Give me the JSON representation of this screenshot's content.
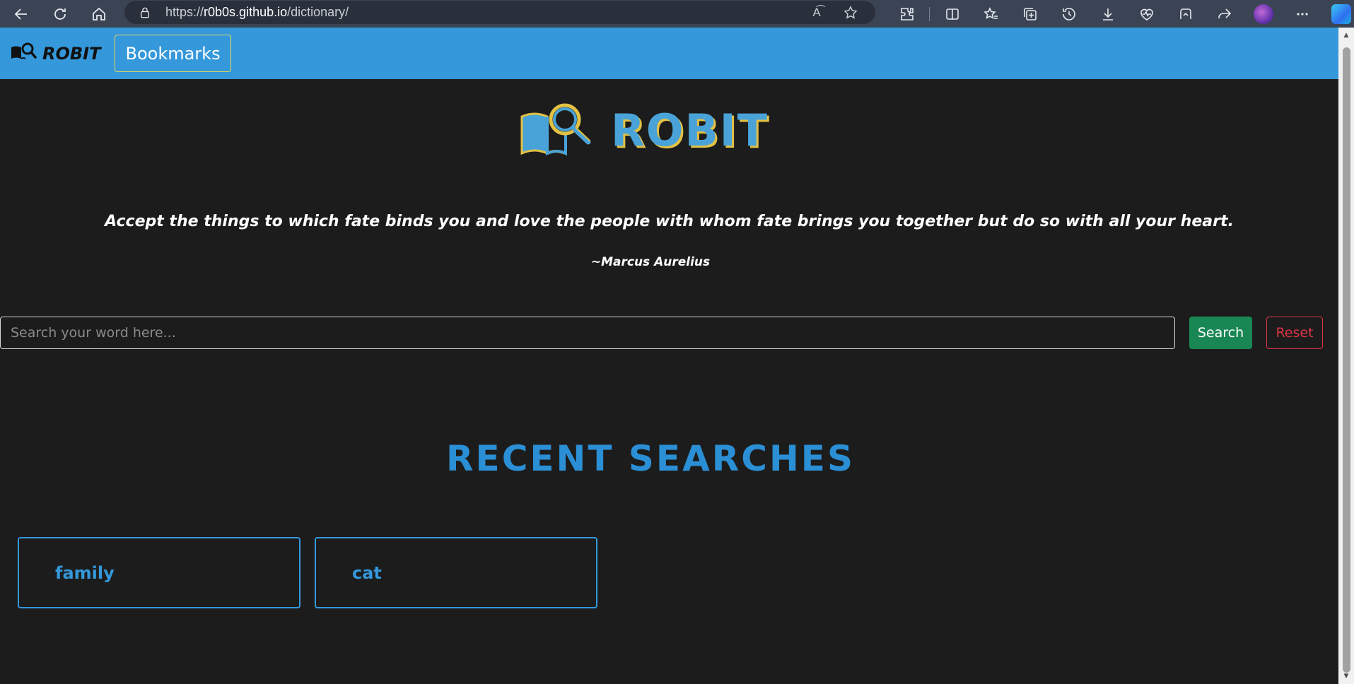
{
  "browser": {
    "url_prefix": "https://",
    "url_host": "r0b0s.github.io",
    "url_path": "/dictionary/",
    "read_aloud_label": "A͡"
  },
  "navbar": {
    "brand": "ROBIT",
    "bookmarks_label": "Bookmarks",
    "accent": "#3498db"
  },
  "hero": {
    "title": "ROBIT"
  },
  "quote": {
    "text": "Accept the things to which fate binds you and love the people with whom fate brings you together but do so with all your heart.",
    "author": "~Marcus Aurelius"
  },
  "search": {
    "placeholder": "Search your word here...",
    "value": "",
    "search_label": "Search",
    "reset_label": "Reset"
  },
  "recent": {
    "title": "RECENT SEARCHES",
    "items": [
      "family",
      "cat"
    ]
  }
}
